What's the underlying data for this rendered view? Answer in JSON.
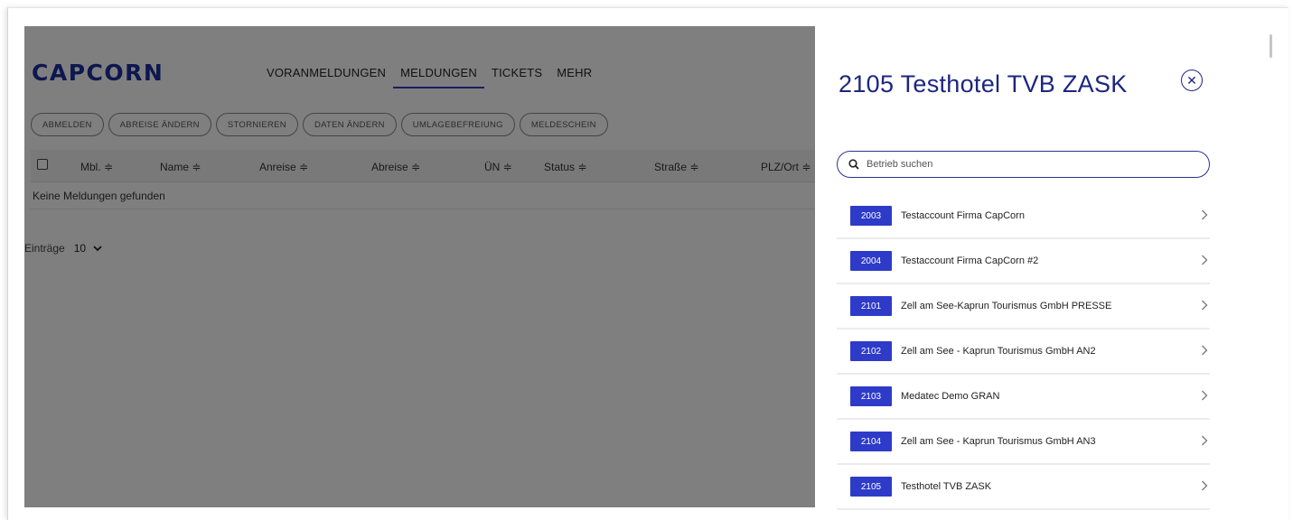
{
  "app": {
    "logo": "CAPCORN",
    "nav": [
      "VORANMELDUNGEN",
      "MELDUNGEN",
      "TICKETS",
      "MEHR"
    ],
    "actions": [
      "ABMELDEN",
      "ABREISE ÄNDERN",
      "STORNIEREN",
      "DATEN ÄNDERN",
      "UMLAGEBEFREIUNG",
      "MELDESCHEIN"
    ],
    "columns": [
      "Mbl. ≑",
      "Name ≑",
      "Anreise ≑",
      "Abreise ≑",
      "ÜN ≑",
      "Status ≑",
      "Straße ≑",
      "PLZ/Ort ≑"
    ],
    "empty_message": "Keine Meldungen gefunden",
    "entries_label": "Einträge",
    "entries_value": "10"
  },
  "panel": {
    "title": "2105 Testhotel TVB ZASK",
    "search_placeholder": "Betrieb suchen",
    "items": [
      {
        "code": "2003",
        "name": "Testaccount Firma CapCorn"
      },
      {
        "code": "2004",
        "name": "Testaccount Firma CapCorn #2"
      },
      {
        "code": "2101",
        "name": "Zell am See-Kaprun Tourismus GmbH PRESSE"
      },
      {
        "code": "2102",
        "name": "Zell am See - Kaprun Tourismus GmbH AN2"
      },
      {
        "code": "2103",
        "name": "Medatec Demo GRAN"
      },
      {
        "code": "2104",
        "name": "Zell am See - Kaprun Tourismus GmbH AN3"
      },
      {
        "code": "2105",
        "name": "Testhotel TVB ZASK"
      }
    ]
  },
  "colors": {
    "brand": "#1d2f9c",
    "badge": "#2e3bc8",
    "title": "#1d2680",
    "overlay": "rgba(0,0,0,0.5)"
  }
}
